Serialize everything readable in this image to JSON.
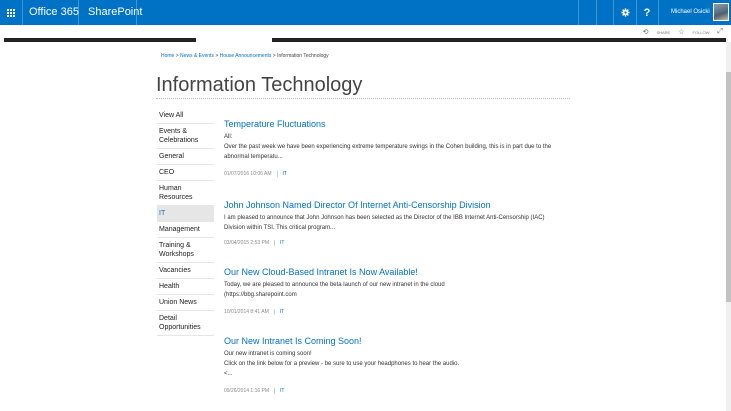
{
  "suitebar": {
    "brand": "Office 365",
    "app": "SharePoint",
    "user_name": "Michael Osicki",
    "settings_icon": "gear-icon",
    "help_label": "?",
    "bg_color": "#0072c6"
  },
  "actions": {
    "share": "SHARE",
    "follow": "FOLLOW"
  },
  "breadcrumb": {
    "items": [
      "Home",
      "News & Events",
      "House Announcements"
    ],
    "separator": ">",
    "current": "Information Technology"
  },
  "page_title": "Information Technology",
  "leftnav": {
    "items": [
      {
        "label": "View All"
      },
      {
        "label": "Events & Celebrations"
      },
      {
        "label": "General"
      },
      {
        "label": "CEO"
      },
      {
        "label": "Human Resources"
      },
      {
        "label": "IT",
        "selected": true
      },
      {
        "label": "Management"
      },
      {
        "label": "Training & Workshops"
      },
      {
        "label": "Vacancies"
      },
      {
        "label": "Health"
      },
      {
        "label": "Union News"
      },
      {
        "label": "Detail Opportunities"
      }
    ]
  },
  "posts": [
    {
      "title": "Temperature Fluctuations",
      "body1": "All:",
      "body2": "Over the past week we have been experiencing extreme temperature swings in the Cohen building, this is in part due to the abnormal temperatu...",
      "date": "01/07/2016 10:06 AM",
      "category": "IT"
    },
    {
      "title": "John Johnson Named Director Of Internet Anti-Censorship Division",
      "body1": "I am pleased to announce that John Johnson has been selected as the Director of the IBB Internet Anti-Censorship (IAC) Division within TSI.  This critical program...",
      "date": "03/04/2015 2:53 PM",
      "category": "IT"
    },
    {
      "title": "Our New Cloud-Based Intranet Is Now Available!",
      "body1": "Today, we are pleased to announce the beta launch of our new intranet in the cloud",
      "body2": "(https://bbg.sharepoint.com",
      "date": "10/01/2014 8:41 AM",
      "category": "IT"
    },
    {
      "title": "Our New Intranet Is Coming Soon!",
      "body1": "Our new intranet is coming soon!",
      "body2": "Click on the link below for a preview - be sure to use your headphones to hear the audio.",
      "body3": "<...",
      "date": "09/26/2014 1:16 PM",
      "category": "IT"
    }
  ]
}
